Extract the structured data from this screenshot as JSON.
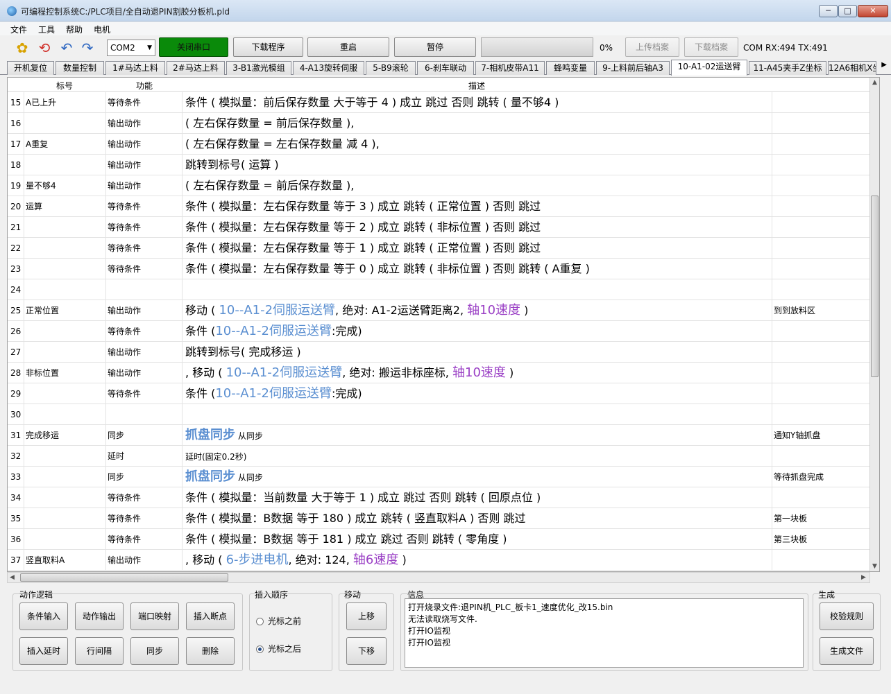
{
  "window": {
    "title": "可编程控制系统C:/PLC项目/全自动退PIN割胶分板机.pld"
  },
  "menu": [
    "文件",
    "工具",
    "帮助",
    "电机"
  ],
  "toolbar": {
    "port": "COM2",
    "close_port": "关闭串口",
    "download_program": "下载程序",
    "restart": "重启",
    "pause": "暂停",
    "progress": "0%",
    "progress_value": 0,
    "upload_file": "上传档案",
    "download_file": "下载档案",
    "com_status": "COM RX:494 TX:491",
    "accent_green": "#0a8a0a"
  },
  "tabs": [
    "开机复位",
    "数量控制",
    "1#马达上料",
    "2#马达上料",
    "3-B1激光模组",
    "4-A13旋转伺服",
    "5-B9滚轮",
    "6-刹车联动",
    "7-相机皮带A11",
    "蜂鸣变量",
    "9-上料前后轴A3",
    "10-A1-02运送臂",
    "11-A45夹手Z坐标",
    "12A6相机X坐"
  ],
  "active_tab": 11,
  "grid": {
    "headers": {
      "label": "标号",
      "func": "功能",
      "desc": "描述"
    },
    "rows": [
      {
        "n": "15",
        "label": "A已上升",
        "func": "等待条件",
        "desc": [
          {
            "t": "条件 ( 模拟量：前后保存数量 大于等于 4 ) 成立 跳过 否则 跳转 ( 量不够4 )"
          }
        ],
        "note": ""
      },
      {
        "n": "16",
        "label": "",
        "func": "输出动作",
        "desc": [
          {
            "t": "( 左右保存数量 = 前后保存数量 ),"
          }
        ],
        "note": ""
      },
      {
        "n": "17",
        "label": "A重复",
        "func": "输出动作",
        "desc": [
          {
            "t": "( 左右保存数量 = 左右保存数量 减 4 ),"
          }
        ],
        "note": ""
      },
      {
        "n": "18",
        "label": "",
        "func": "输出动作",
        "desc": [
          {
            "t": "跳转到标号( 运算 )"
          }
        ],
        "note": ""
      },
      {
        "n": "19",
        "label": "量不够4",
        "func": "输出动作",
        "desc": [
          {
            "t": "( 左右保存数量 = 前后保存数量 ),"
          }
        ],
        "note": ""
      },
      {
        "n": "20",
        "label": "运算",
        "func": "等待条件",
        "desc": [
          {
            "t": "条件 ( 模拟量：左右保存数量 等于 3 ) 成立 跳转 ( 正常位置 ) 否则 跳过"
          }
        ],
        "note": ""
      },
      {
        "n": "21",
        "label": "",
        "func": "等待条件",
        "desc": [
          {
            "t": "条件 ( 模拟量：左右保存数量 等于 2 ) 成立 跳转 ( 非标位置 ) 否则 跳过"
          }
        ],
        "note": ""
      },
      {
        "n": "22",
        "label": "",
        "func": "等待条件",
        "desc": [
          {
            "t": "条件 ( 模拟量：左右保存数量 等于 1 ) 成立 跳转 ( 正常位置 ) 否则 跳过"
          }
        ],
        "note": ""
      },
      {
        "n": "23",
        "label": "",
        "func": "等待条件",
        "desc": [
          {
            "t": "条件 ( 模拟量：左右保存数量 等于 0 ) 成立 跳转 ( 非标位置 ) 否则 跳转 ( A重复 )"
          }
        ],
        "note": ""
      },
      {
        "n": "24",
        "label": "",
        "func": "",
        "desc": [],
        "note": ""
      },
      {
        "n": "25",
        "label": "正常位置",
        "func": "输出动作",
        "desc": [
          {
            "t": "移动 ( "
          },
          {
            "t": "10--A1-2伺服运送臂",
            "c": "hl-blue"
          },
          {
            "t": ",  绝对:  A1-2运送臂距离2,  "
          },
          {
            "t": "轴10速度",
            "c": "hl-purple"
          },
          {
            "t": " )"
          }
        ],
        "note": "到到放料区"
      },
      {
        "n": "26",
        "label": "",
        "func": "等待条件",
        "desc": [
          {
            "t": "条件 ("
          },
          {
            "t": "10--A1-2伺服运送臂",
            "c": "hl-blue"
          },
          {
            "t": ":完成)"
          }
        ],
        "note": ""
      },
      {
        "n": "27",
        "label": "",
        "func": "输出动作",
        "desc": [
          {
            "t": "跳转到标号( 完成移运 )"
          }
        ],
        "note": ""
      },
      {
        "n": "28",
        "label": "非标位置",
        "func": "输出动作",
        "desc": [
          {
            "t": ", 移动 ( "
          },
          {
            "t": "10--A1-2伺服运送臂",
            "c": "hl-blue"
          },
          {
            "t": ",  绝对:  搬运非标座标,  "
          },
          {
            "t": "轴10速度",
            "c": "hl-purple"
          },
          {
            "t": " )"
          }
        ],
        "note": ""
      },
      {
        "n": "29",
        "label": "",
        "func": "等待条件",
        "desc": [
          {
            "t": "条件 ("
          },
          {
            "t": "10--A1-2伺服运送臂",
            "c": "hl-blue"
          },
          {
            "t": ":完成)"
          }
        ],
        "note": ""
      },
      {
        "n": "30",
        "label": "",
        "func": "",
        "desc": [],
        "note": ""
      },
      {
        "n": "31",
        "label": "完成移运",
        "func": "同步",
        "desc": [
          {
            "t": "抓盘同步",
            "c": "bold-blue"
          },
          {
            "t": " 从同步",
            "c": "small"
          }
        ],
        "note": "通知Y轴抓盘"
      },
      {
        "n": "32",
        "label": "",
        "func": "延时",
        "desc": [
          {
            "t": "延时(固定0.2秒)",
            "c": "small"
          }
        ],
        "note": ""
      },
      {
        "n": "33",
        "label": "",
        "func": "同步",
        "desc": [
          {
            "t": "抓盘同步",
            "c": "bold-blue"
          },
          {
            "t": " 从同步",
            "c": "small"
          }
        ],
        "note": "等待抓盘完成"
      },
      {
        "n": "34",
        "label": "",
        "func": "等待条件",
        "desc": [
          {
            "t": "条件 ( 模拟量：当前数量 大于等于 1 ) 成立 跳过 否则 跳转 ( 回原点位 )"
          }
        ],
        "note": ""
      },
      {
        "n": "35",
        "label": "",
        "func": "等待条件",
        "desc": [
          {
            "t": "条件 ( 模拟量：B数据 等于 180 ) 成立 跳转 ( 竖直取料A ) 否则 跳过"
          }
        ],
        "note": "第一块板"
      },
      {
        "n": "36",
        "label": "",
        "func": "等待条件",
        "desc": [
          {
            "t": "条件 ( 模拟量：B数据 等于 181 ) 成立 跳过 否则 跳转 ( 零角度 )"
          }
        ],
        "note": "第三块板"
      },
      {
        "n": "37",
        "label": "竖直取料A",
        "func": "输出动作",
        "desc": [
          {
            "t": ", 移动 ( "
          },
          {
            "t": "6-步进电机",
            "c": "hl-blue"
          },
          {
            "t": ",  绝对:  124,  "
          },
          {
            "t": "轴6速度",
            "c": "hl-purple"
          },
          {
            "t": " )"
          }
        ],
        "note": ""
      }
    ]
  },
  "panel": {
    "logic_title": "动作逻辑",
    "logic_buttons": [
      "条件输入",
      "动作输出",
      "端口映射",
      "插入断点",
      "插入延时",
      "行间隔",
      "同步",
      "删除"
    ],
    "insert_title": "插入顺序",
    "insert_before": "光标之前",
    "insert_after": "光标之后",
    "move_title": "移动",
    "move_up": "上移",
    "move_down": "下移",
    "info_title": "信息",
    "info_lines": [
      "打开烧录文件:退PIN机_PLC_板卡1_速度优化_改15.bin",
      "无法读取烧写文件.",
      "打开IO监视",
      "打开IO监视"
    ],
    "gen_title": "生成",
    "check_rules": "校验规则",
    "gen_file": "生成文件"
  }
}
